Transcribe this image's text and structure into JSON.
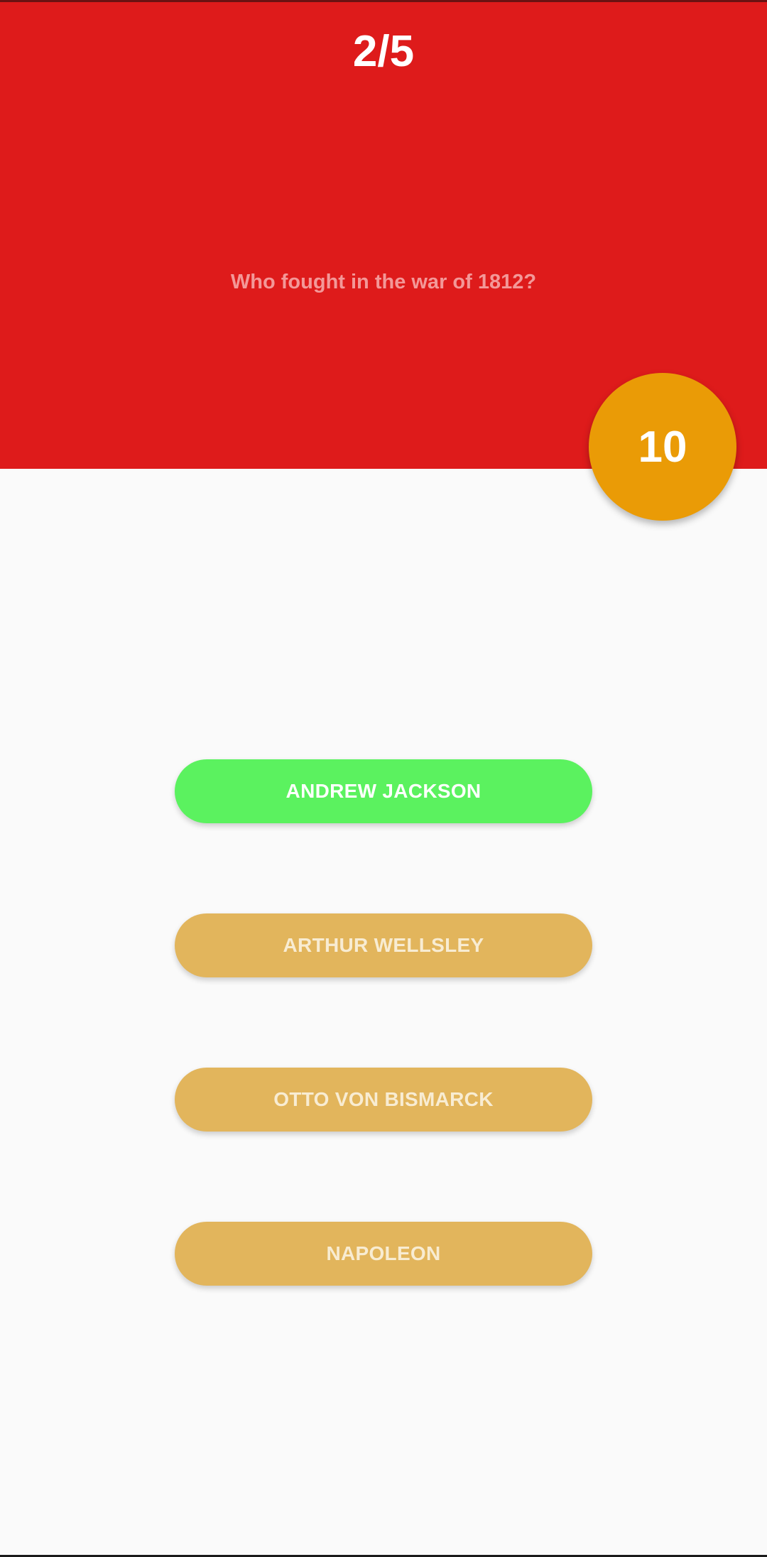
{
  "quiz": {
    "progress": "2/5",
    "question": "Who fought in the war of 1812?",
    "timer": "10",
    "answers": [
      {
        "label": "ANDREW JACKSON",
        "state": "correct"
      },
      {
        "label": "ARTHUR WELLSLEY",
        "state": "default"
      },
      {
        "label": "OTTO VON BISMARCK",
        "state": "default"
      },
      {
        "label": "NAPOLEON",
        "state": "default"
      }
    ]
  },
  "colors": {
    "header_bg": "#de1b1b",
    "timer_bg": "#ea9b06",
    "answer_bg": "#e2b55c",
    "correct_bg": "#5bf25f",
    "page_bg": "#fafafa"
  }
}
